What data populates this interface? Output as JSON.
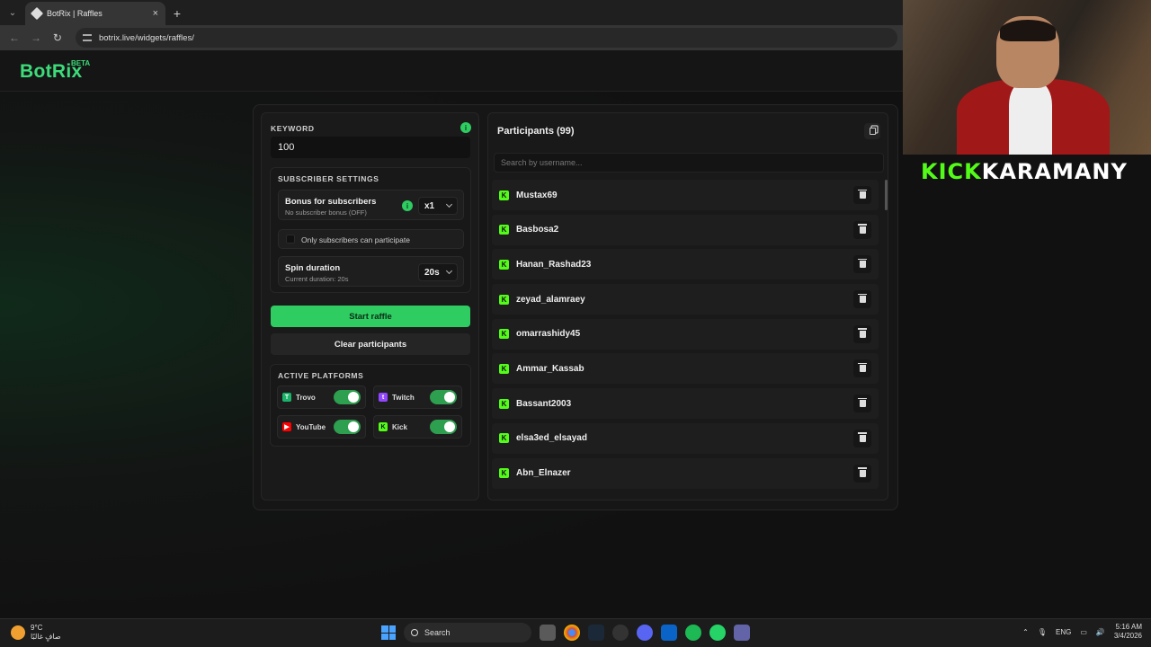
{
  "browser": {
    "tab_title": "BotRix | Raffles",
    "tab_close": "×",
    "new_tab": "+",
    "url": "botrix.live/widgets/raffles/"
  },
  "app": {
    "logo": "BotRix",
    "badge": "BETA",
    "brand_color": "#3ddc7a"
  },
  "raffle": {
    "keyword_label": "KEYWORD",
    "keyword_value": "100",
    "subscriber_settings_label": "SUBSCRIBER SETTINGS",
    "bonus_title": "Bonus for subscribers",
    "bonus_sub": "No subscriber bonus (OFF)",
    "bonus_value": "x1",
    "only_subs_label": "Only subscribers can participate",
    "only_subs_checked": false,
    "spin_title": "Spin duration",
    "spin_sub": "Current duration: 20s",
    "spin_value": "20s",
    "start_label": "Start raffle",
    "clear_label": "Clear participants",
    "platforms_label": "ACTIVE PLATFORMS",
    "platforms": [
      {
        "name": "Trovo",
        "enabled": true,
        "icon": "trovo-icon",
        "color": "#1bb36a"
      },
      {
        "name": "Twitch",
        "enabled": true,
        "icon": "twitch-icon",
        "color": "#9146ff"
      },
      {
        "name": "YouTube",
        "enabled": true,
        "icon": "youtube-icon",
        "color": "#ff0000"
      },
      {
        "name": "Kick",
        "enabled": true,
        "icon": "kick-icon",
        "color": "#53fc18"
      }
    ]
  },
  "participants": {
    "title": "Participants (99)",
    "search_placeholder": "Search by username...",
    "items": [
      "Mustax69",
      "Basbosa2",
      "Hanan_Rashad23",
      "zeyad_alamraey",
      "omarrashidy45",
      "Ammar_Kassab",
      "Bassant2003",
      "elsa3ed_elsayad",
      "Abn_Elnazer"
    ]
  },
  "stream_overlay": {
    "part1": "KICK",
    "part2": "KARAMANY"
  },
  "taskbar": {
    "weather_temp": "9°C",
    "weather_desc": "صافٍ غالبًا",
    "search_label": "Search",
    "lang": "ENG",
    "time": "5:16 AM",
    "date": "3/4/2026"
  }
}
